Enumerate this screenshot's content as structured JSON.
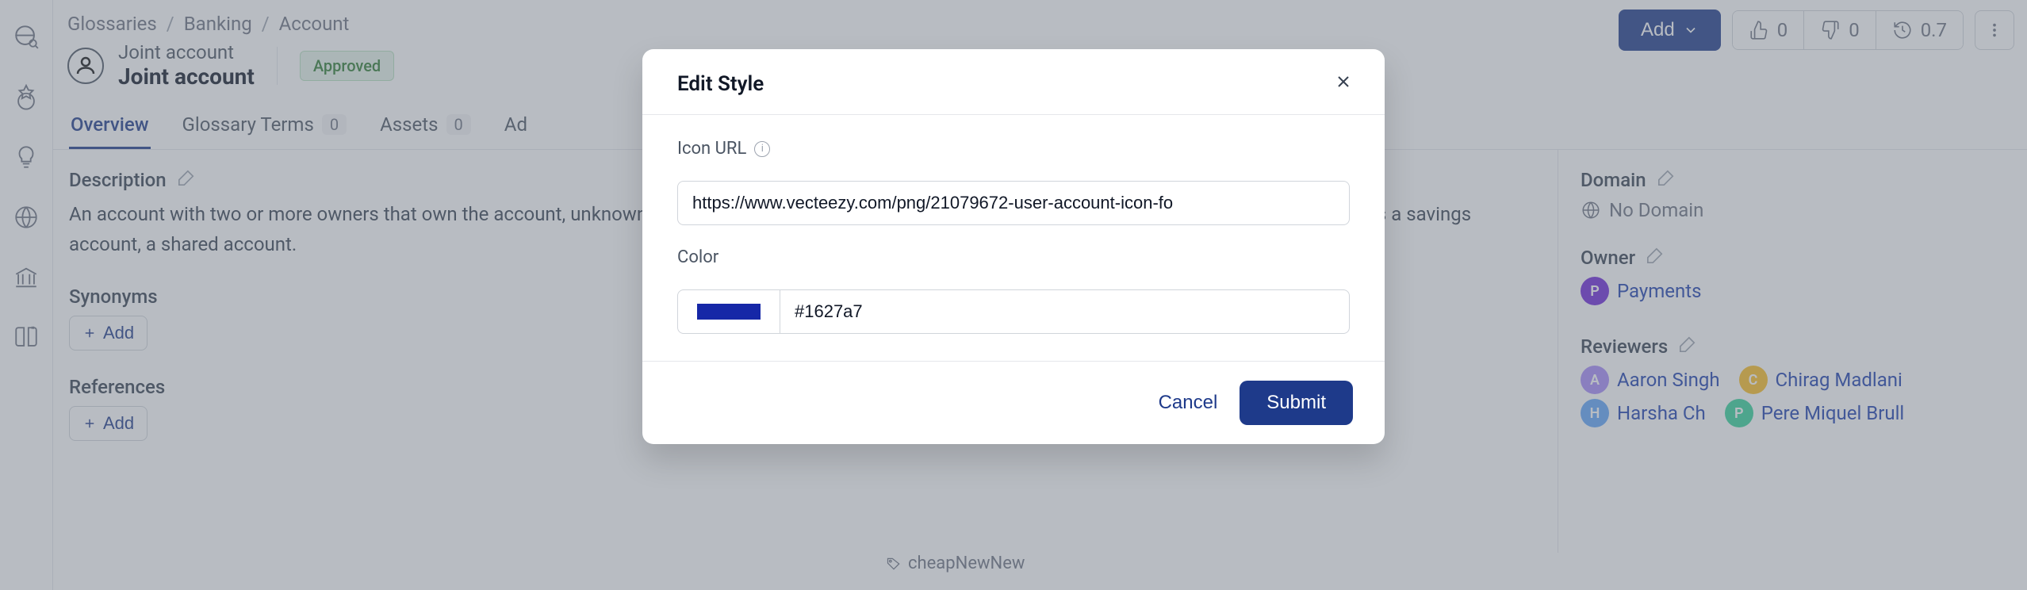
{
  "breadcrumbs": [
    "Glossaries",
    "Banking",
    "Account"
  ],
  "page": {
    "subtitle": "Joint account",
    "title": "Joint account",
    "status": "Approved"
  },
  "topbar": {
    "add_label": "Add",
    "like_count": "0",
    "dislike_count": "0",
    "version": "0.7"
  },
  "tabs": [
    {
      "label": "Overview",
      "active": true
    },
    {
      "label": "Glossary Terms",
      "count": "0"
    },
    {
      "label": "Assets",
      "count": "0"
    },
    {
      "label": "Ad"
    }
  ],
  "description": {
    "heading": "Description",
    "text": "An account with two or more owners that own the account, unknown, of a bank, for example, many married couples have a joint checking account, as well as a savings account, a shared account."
  },
  "synonyms": {
    "heading": "Synonyms",
    "add_label": "Add"
  },
  "references": {
    "heading": "References",
    "add_label": "Add"
  },
  "tag": {
    "label": "cheapNewNew"
  },
  "domain": {
    "heading": "Domain",
    "value": "No Domain"
  },
  "owner": {
    "heading": "Owner",
    "chip": {
      "initial": "P",
      "name": "Payments"
    }
  },
  "reviewers": {
    "heading": "Reviewers",
    "items": [
      {
        "initial": "A",
        "name": "Aaron Singh",
        "cls": "img1"
      },
      {
        "initial": "C",
        "name": "Chirag Madlani",
        "cls": "img2"
      },
      {
        "initial": "H",
        "name": "Harsha Ch",
        "cls": "img3"
      },
      {
        "initial": "P",
        "name": "Pere Miquel Brull",
        "cls": "img4"
      }
    ]
  },
  "modal": {
    "title": "Edit Style",
    "icon_url_label": "Icon URL",
    "icon_url_value": "https://www.vecteezy.com/png/21079672-user-account-icon-fo",
    "color_label": "Color",
    "color_swatch": "#1627a7",
    "color_hex": "#1627a7",
    "cancel": "Cancel",
    "submit": "Submit"
  }
}
